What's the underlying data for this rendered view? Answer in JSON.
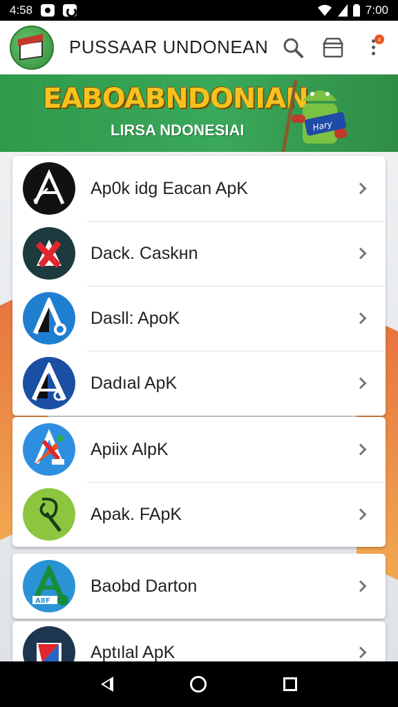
{
  "status_bar": {
    "time_left": "4:58",
    "time_right": "7:00"
  },
  "app_bar": {
    "title": "PUSSAAR UNDONEAN",
    "icons": [
      "app-logo",
      "search-icon",
      "store-icon",
      "more-vert-icon"
    ],
    "badge": "x"
  },
  "banner": {
    "title": "EABOABNDONIAN",
    "subtitle": "LIRSA NDONESIAI",
    "sign_text": "Hary"
  },
  "list": {
    "items": [
      {
        "label": "Ap0k idg Eacan ApK",
        "icon": "app-icon-black-a"
      },
      {
        "label": "Dack. Caskнn",
        "icon": "app-icon-red-x"
      },
      {
        "label": "Dasll: ApoK",
        "icon": "app-icon-blue-a"
      },
      {
        "label": "Dadıal ApK",
        "icon": "app-icon-navy-a"
      },
      {
        "label": "Apiix AlpK",
        "icon": "app-icon-blue-arrow"
      },
      {
        "label": "Apak. FApK",
        "icon": "app-icon-green-leaf"
      },
      {
        "label": "Baobd Darton",
        "icon": "app-icon-teal-a"
      },
      {
        "label": "Aptılal ApK",
        "icon": "app-icon-dark-arrow"
      }
    ],
    "icon_badges": {
      "row3": "",
      "row7": "A8F"
    }
  },
  "colors": {
    "banner_green": "#2e9a4a",
    "banner_title": "#f7c21f",
    "accent_orange": "#e5652a"
  },
  "nav_bar": {
    "icons": [
      "back-icon",
      "home-icon",
      "recents-icon"
    ]
  }
}
